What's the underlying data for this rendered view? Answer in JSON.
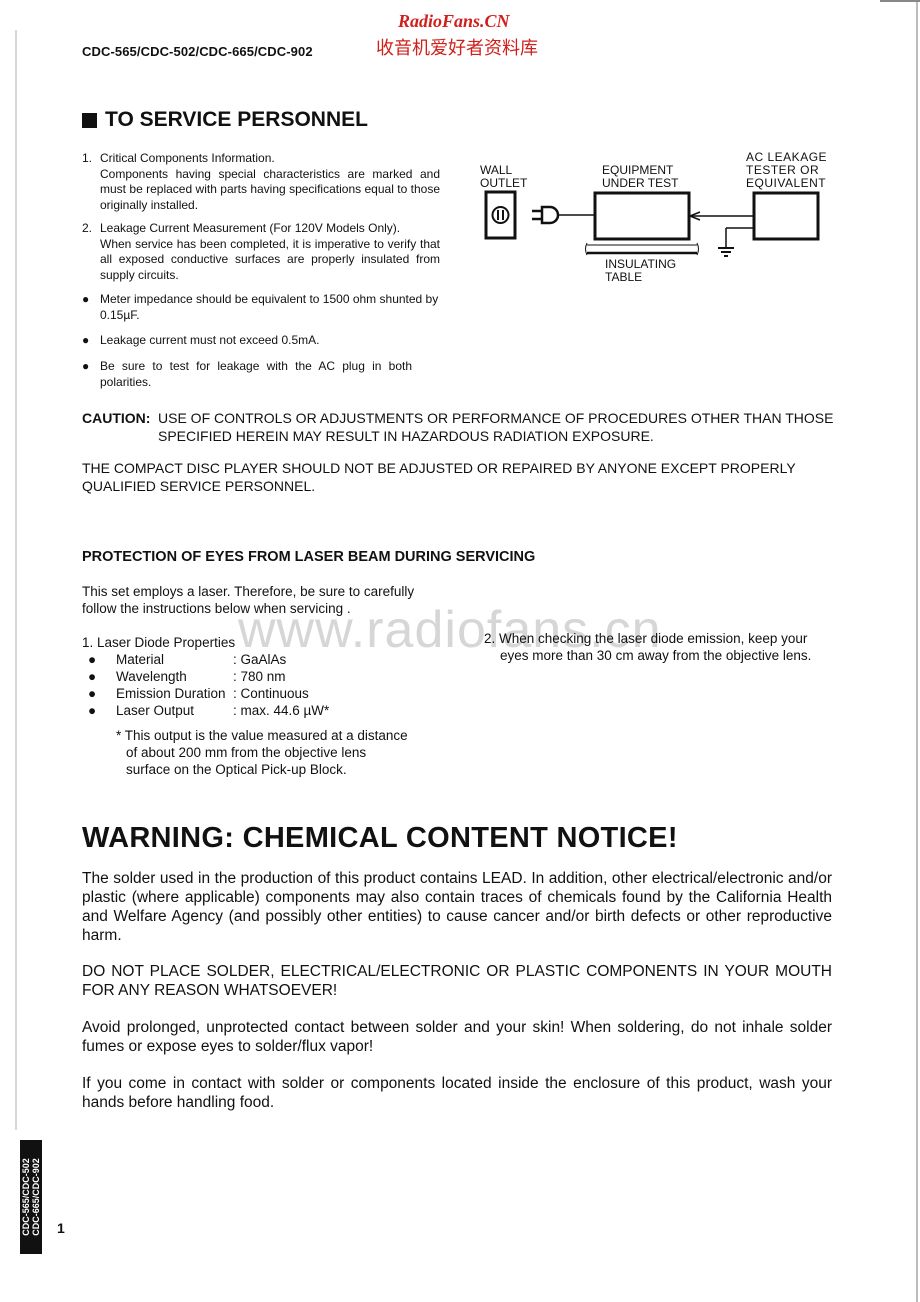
{
  "header": {
    "models": "CDC-565/CDC-502/CDC-665/CDC-902",
    "watermark_brand": "RadioFans.CN",
    "watermark_cn": "收音机爱好者资料库",
    "watermark_url": "www.radiofans.cn"
  },
  "service": {
    "title": "TO SERVICE PERSONNEL",
    "items": [
      {
        "num": "1.",
        "lines": [
          "Critical Components Information.",
          "Components having special characteristics are marked and must be replaced with parts having specifications equal to those originally installed."
        ]
      },
      {
        "num": "2.",
        "lines": [
          "Leakage Current Measurement (For 120V Models Only).",
          "When service has been completed, it is imperative to verify that all exposed conductive surfaces are properly insulated from supply circuits."
        ]
      }
    ],
    "bullets": [
      "Meter impedance should be equivalent to 1500 ohm shunted by 0.15µF.",
      "Leakage current must not exceed 0.5mA.",
      "Be sure to test for leakage with the AC plug in both polarities."
    ],
    "diagram": {
      "wall_outlet": [
        "WALL",
        "OUTLET"
      ],
      "equipment": [
        "EQUIPMENT",
        "UNDER TEST"
      ],
      "tester": [
        "AC LEAKAGE",
        "TESTER OR",
        "EQUIVALENT"
      ],
      "table": [
        "INSULATING",
        "TABLE"
      ]
    }
  },
  "caution": {
    "label": "CAUTION:",
    "line1": "USE OF CONTROLS OR ADJUSTMENTS OR PERFORMANCE OF PROCEDURES OTHER THAN THOSE",
    "line2": "SPECIFIED HEREIN MAY RESULT IN HAZARDOUS RADIATION EXPOSURE."
  },
  "cd_note": [
    "THE COMPACT DISC PLAYER SHOULD NOT BE ADJUSTED OR REPAIRED BY ANYONE EXCEPT PROPERLY",
    "QUALIFIED SERVICE PERSONNEL."
  ],
  "laser": {
    "title": "PROTECTION OF EYES FROM LASER BEAM DURING SERVICING",
    "intro": [
      "This set employs a laser. Therefore, be sure to carefully",
      "follow  the instructions below when servicing ."
    ],
    "item1_title": "1. Laser Diode Properties",
    "properties": [
      {
        "key": "Material",
        "value": ": GaAlAs"
      },
      {
        "key": "Wavelength",
        "value": ": 780 nm"
      },
      {
        "key": "Emission Duration",
        "value": ": Continuous"
      },
      {
        "key": "Laser Output",
        "value": ": max. 44.6 µW*"
      }
    ],
    "footnote": [
      "* This output is the value measured at a distance",
      "of about 200 mm from the objective lens",
      "surface on the Optical Pick-up Block."
    ],
    "item2": [
      "2. When checking the laser diode emission, keep your",
      "eyes more than 30 cm away from the objective lens."
    ]
  },
  "warning": {
    "title": "WARNING: CHEMICAL CONTENT NOTICE!",
    "paragraphs": [
      "The solder used in the production of this product contains LEAD. In addition, other electrical/electronic and/or plastic (where applicable) components may also contain traces of chemicals found by the California Health and Welfare Agency (and possibly other entities) to cause cancer and/or birth defects or other reproductive harm.",
      "DO NOT PLACE SOLDER, ELECTRICAL/ELECTRONIC OR PLASTIC COMPONENTS IN YOUR MOUTH FOR ANY REASON WHATSOEVER!",
      "Avoid prolonged, unprotected contact between solder and your skin! When soldering, do not inhale solder fumes or expose eyes to solder/flux vapor!",
      "If you come in contact with solder or components located inside the enclosure of this product, wash your hands before handling food."
    ]
  },
  "footer": {
    "side_tab": [
      "CDC-565/CDC-502",
      "CDC-665/CDC-902"
    ],
    "page_number": "1"
  }
}
